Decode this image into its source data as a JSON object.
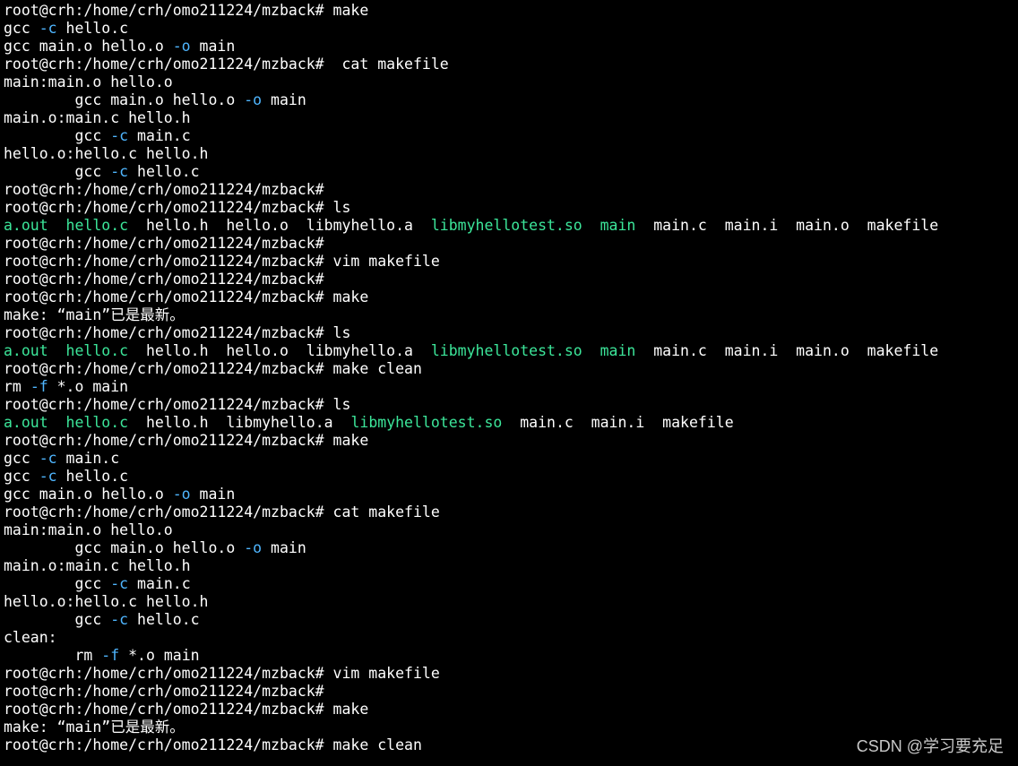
{
  "colors": {
    "background": "#000000",
    "plain": "#ffffff",
    "flag": "#4fb6ff",
    "exec": "#3ce69a",
    "watermark": "#c8c8c8"
  },
  "watermark": "CSDN @学习要充足",
  "lines": [
    [
      {
        "t": "root@crh:/home/crh/omo211224/mzback# make",
        "c": "plain"
      }
    ],
    [
      {
        "t": "gcc ",
        "c": "plain"
      },
      {
        "t": "-c",
        "c": "flag"
      },
      {
        "t": " hello.c",
        "c": "plain"
      }
    ],
    [
      {
        "t": "gcc main.o hello.o ",
        "c": "plain"
      },
      {
        "t": "-o",
        "c": "flag"
      },
      {
        "t": " main",
        "c": "plain"
      }
    ],
    [
      {
        "t": "root@crh:/home/crh/omo211224/mzback#  cat makefile",
        "c": "plain"
      }
    ],
    [
      {
        "t": "main:main.o hello.o",
        "c": "plain"
      }
    ],
    [
      {
        "t": "        gcc main.o hello.o ",
        "c": "plain"
      },
      {
        "t": "-o",
        "c": "flag"
      },
      {
        "t": " main",
        "c": "plain"
      }
    ],
    [
      {
        "t": "main.o:main.c hello.h",
        "c": "plain"
      }
    ],
    [
      {
        "t": "        gcc ",
        "c": "plain"
      },
      {
        "t": "-c",
        "c": "flag"
      },
      {
        "t": " main.c",
        "c": "plain"
      }
    ],
    [
      {
        "t": "hello.o:hello.c hello.h",
        "c": "plain"
      }
    ],
    [
      {
        "t": "        gcc ",
        "c": "plain"
      },
      {
        "t": "-c",
        "c": "flag"
      },
      {
        "t": " hello.c",
        "c": "plain"
      }
    ],
    [
      {
        "t": "root@crh:/home/crh/omo211224/mzback#",
        "c": "plain"
      }
    ],
    [
      {
        "t": "root@crh:/home/crh/omo211224/mzback# ls",
        "c": "plain"
      }
    ],
    [
      {
        "t": "a.out",
        "c": "exec"
      },
      {
        "t": "  ",
        "c": "plain"
      },
      {
        "t": "hello.c",
        "c": "exec"
      },
      {
        "t": "  hello.h  hello.o  libmyhello.a  ",
        "c": "plain"
      },
      {
        "t": "libmyhellotest.so",
        "c": "exec"
      },
      {
        "t": "  ",
        "c": "plain"
      },
      {
        "t": "main",
        "c": "exec"
      },
      {
        "t": "  main.c  main.i  main.o  makefile",
        "c": "plain"
      }
    ],
    [
      {
        "t": "root@crh:/home/crh/omo211224/mzback#",
        "c": "plain"
      }
    ],
    [
      {
        "t": "root@crh:/home/crh/omo211224/mzback# vim makefile",
        "c": "plain"
      }
    ],
    [
      {
        "t": "root@crh:/home/crh/omo211224/mzback#",
        "c": "plain"
      }
    ],
    [
      {
        "t": "root@crh:/home/crh/omo211224/mzback# make",
        "c": "plain"
      }
    ],
    [
      {
        "t": "make: “main”已是最新。",
        "c": "plain"
      }
    ],
    [
      {
        "t": "root@crh:/home/crh/omo211224/mzback# ls",
        "c": "plain"
      }
    ],
    [
      {
        "t": "a.out",
        "c": "exec"
      },
      {
        "t": "  ",
        "c": "plain"
      },
      {
        "t": "hello.c",
        "c": "exec"
      },
      {
        "t": "  hello.h  hello.o  libmyhello.a  ",
        "c": "plain"
      },
      {
        "t": "libmyhellotest.so",
        "c": "exec"
      },
      {
        "t": "  ",
        "c": "plain"
      },
      {
        "t": "main",
        "c": "exec"
      },
      {
        "t": "  main.c  main.i  main.o  makefile",
        "c": "plain"
      }
    ],
    [
      {
        "t": "root@crh:/home/crh/omo211224/mzback# make clean",
        "c": "plain"
      }
    ],
    [
      {
        "t": "rm ",
        "c": "plain"
      },
      {
        "t": "-f",
        "c": "flag"
      },
      {
        "t": " *.o main",
        "c": "plain"
      }
    ],
    [
      {
        "t": "root@crh:/home/crh/omo211224/mzback# ls",
        "c": "plain"
      }
    ],
    [
      {
        "t": "a.out",
        "c": "exec"
      },
      {
        "t": "  ",
        "c": "plain"
      },
      {
        "t": "hello.c",
        "c": "exec"
      },
      {
        "t": "  hello.h  libmyhello.a  ",
        "c": "plain"
      },
      {
        "t": "libmyhellotest.so",
        "c": "exec"
      },
      {
        "t": "  main.c  main.i  makefile",
        "c": "plain"
      }
    ],
    [
      {
        "t": "root@crh:/home/crh/omo211224/mzback# make",
        "c": "plain"
      }
    ],
    [
      {
        "t": "gcc ",
        "c": "plain"
      },
      {
        "t": "-c",
        "c": "flag"
      },
      {
        "t": " main.c",
        "c": "plain"
      }
    ],
    [
      {
        "t": "gcc ",
        "c": "plain"
      },
      {
        "t": "-c",
        "c": "flag"
      },
      {
        "t": " hello.c",
        "c": "plain"
      }
    ],
    [
      {
        "t": "gcc main.o hello.o ",
        "c": "plain"
      },
      {
        "t": "-o",
        "c": "flag"
      },
      {
        "t": " main",
        "c": "plain"
      }
    ],
    [
      {
        "t": "root@crh:/home/crh/omo211224/mzback# cat makefile",
        "c": "plain"
      }
    ],
    [
      {
        "t": "main:main.o hello.o",
        "c": "plain"
      }
    ],
    [
      {
        "t": "        gcc main.o hello.o ",
        "c": "plain"
      },
      {
        "t": "-o",
        "c": "flag"
      },
      {
        "t": " main",
        "c": "plain"
      }
    ],
    [
      {
        "t": "main.o:main.c hello.h",
        "c": "plain"
      }
    ],
    [
      {
        "t": "        gcc ",
        "c": "plain"
      },
      {
        "t": "-c",
        "c": "flag"
      },
      {
        "t": " main.c",
        "c": "plain"
      }
    ],
    [
      {
        "t": "hello.o:hello.c hello.h",
        "c": "plain"
      }
    ],
    [
      {
        "t": "        gcc ",
        "c": "plain"
      },
      {
        "t": "-c",
        "c": "flag"
      },
      {
        "t": " hello.c",
        "c": "plain"
      }
    ],
    [
      {
        "t": "clean:",
        "c": "plain"
      }
    ],
    [
      {
        "t": "        rm ",
        "c": "plain"
      },
      {
        "t": "-f",
        "c": "flag"
      },
      {
        "t": " *.o main",
        "c": "plain"
      }
    ],
    [
      {
        "t": "root@crh:/home/crh/omo211224/mzback# vim makefile",
        "c": "plain"
      }
    ],
    [
      {
        "t": "root@crh:/home/crh/omo211224/mzback#",
        "c": "plain"
      }
    ],
    [
      {
        "t": "root@crh:/home/crh/omo211224/mzback# make",
        "c": "plain"
      }
    ],
    [
      {
        "t": "make: “main”已是最新。",
        "c": "plain"
      }
    ],
    [
      {
        "t": "root@crh:/home/crh/omo211224/mzback# make clean",
        "c": "plain"
      }
    ]
  ]
}
